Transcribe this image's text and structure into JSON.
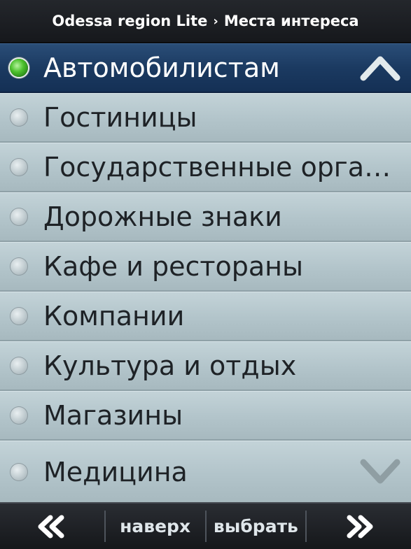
{
  "header": {
    "app_name": "Odessa region Lite",
    "separator": "›",
    "section": "Места интереса"
  },
  "list": {
    "selected_index": 0,
    "items": [
      {
        "label": "Автомобилистам"
      },
      {
        "label": "Гостиницы"
      },
      {
        "label": "Государственные организ..."
      },
      {
        "label": "Дорожные знаки"
      },
      {
        "label": "Кафе и рестораны"
      },
      {
        "label": "Компании"
      },
      {
        "label": "Культура и отдых"
      },
      {
        "label": "Магазины"
      },
      {
        "label": "Медицина"
      }
    ],
    "scroll_up_icon": "chevron-up-icon",
    "scroll_down_icon": "chevron-down-icon"
  },
  "footer": {
    "back_icon": "double-left-icon",
    "top_label": "наверх",
    "select_label": "выбрать",
    "forward_icon": "double-right-icon"
  },
  "colors": {
    "header_bg": "#1c1f24",
    "selected_row_bg": "#1b3a61",
    "row_bg": "#b2c4ca",
    "radio_selected": "#4ec22e",
    "footer_text": "#dfe6ea"
  }
}
